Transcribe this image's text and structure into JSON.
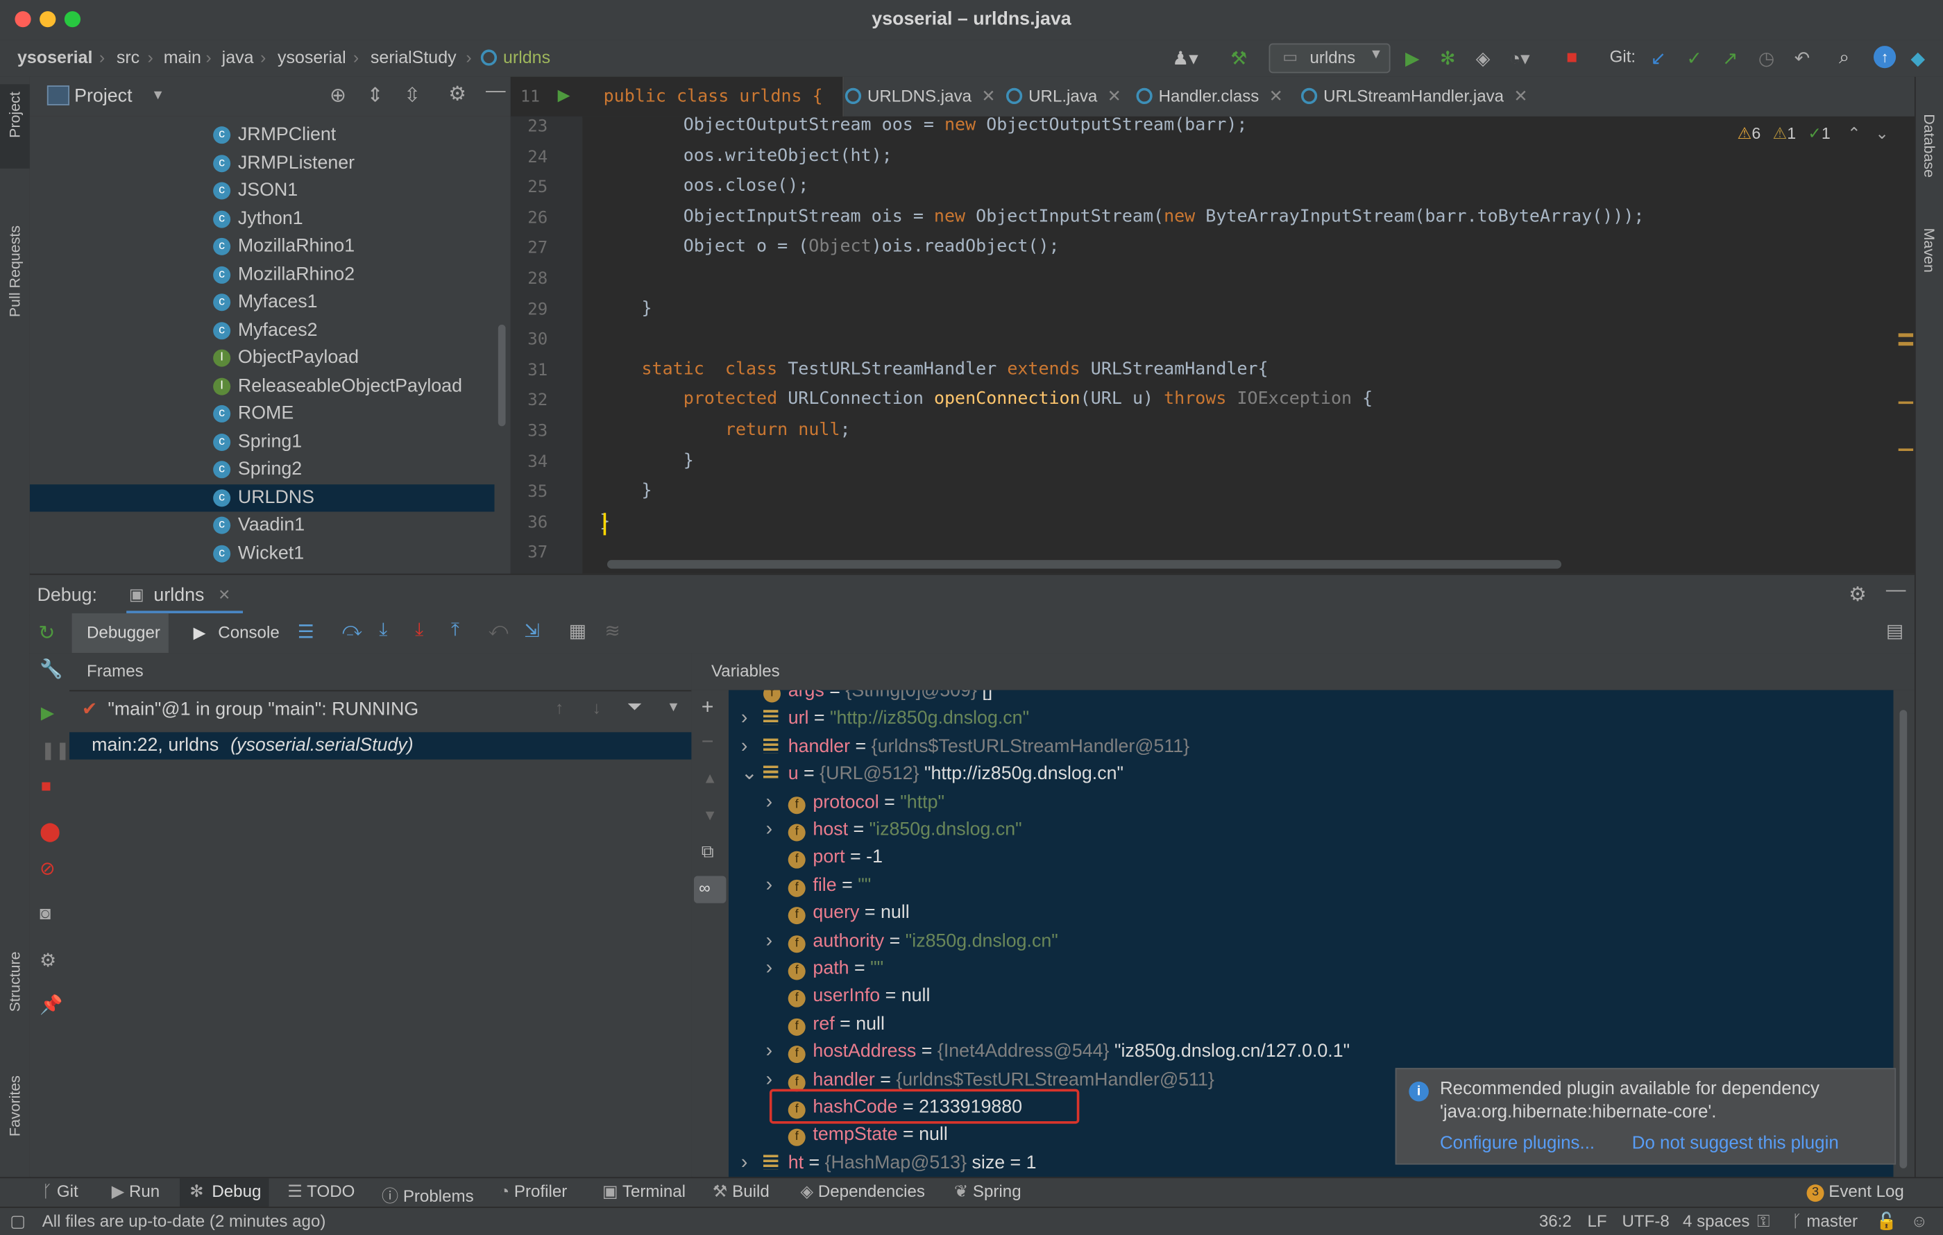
{
  "window": {
    "title": "ysoserial – urldns.java"
  },
  "breadcrumb": [
    "ysoserial",
    "src",
    "main",
    "java",
    "ysoserial",
    "serialStudy",
    "urldns"
  ],
  "toolbar": {
    "run_config": "urldns",
    "git_label": "Git:"
  },
  "project_panel": {
    "title": "Project",
    "items": [
      {
        "label": "JRMPClient",
        "kind": "class"
      },
      {
        "label": "JRMPListener",
        "kind": "class"
      },
      {
        "label": "JSON1",
        "kind": "class"
      },
      {
        "label": "Jython1",
        "kind": "class"
      },
      {
        "label": "MozillaRhino1",
        "kind": "class"
      },
      {
        "label": "MozillaRhino2",
        "kind": "class"
      },
      {
        "label": "Myfaces1",
        "kind": "class"
      },
      {
        "label": "Myfaces2",
        "kind": "class"
      },
      {
        "label": "ObjectPayload",
        "kind": "interface"
      },
      {
        "label": "ReleaseableObjectPayload",
        "kind": "interface"
      },
      {
        "label": "ROME",
        "kind": "class"
      },
      {
        "label": "Spring1",
        "kind": "class"
      },
      {
        "label": "Spring2",
        "kind": "class"
      },
      {
        "label": "URLDNS",
        "kind": "class",
        "selected": true
      },
      {
        "label": "Vaadin1",
        "kind": "class"
      },
      {
        "label": "Wicket1",
        "kind": "class"
      }
    ]
  },
  "left_strip": {
    "project": "Project",
    "pull_requests": "Pull Requests",
    "structure": "Structure",
    "favorites": "Favorites"
  },
  "right_strip": {
    "database": "Database",
    "maven": "Maven"
  },
  "editor": {
    "sticky_line": "11",
    "sticky_code": "public class urldns {",
    "tabs": [
      "URLDNS.java",
      "URL.java",
      "Handler.class",
      "URLStreamHandler.java"
    ],
    "inspections": {
      "warnings": "6",
      "weak": "1",
      "ok": "1"
    },
    "lines": [
      {
        "n": "23",
        "code": "        ObjectOutputStream oos = new ObjectOutputStream(barr);"
      },
      {
        "n": "24",
        "code": "        oos.writeObject(ht);"
      },
      {
        "n": "25",
        "code": "        oos.close();"
      },
      {
        "n": "26",
        "code": "        ObjectInputStream ois = new ObjectInputStream(new ByteArrayInputStream(barr.toByteArray()));"
      },
      {
        "n": "27",
        "code": "        Object o = (Object)ois.readObject();"
      },
      {
        "n": "28",
        "code": ""
      },
      {
        "n": "29",
        "code": "    }"
      },
      {
        "n": "30",
        "code": ""
      },
      {
        "n": "31",
        "code": "    static  class TestURLStreamHandler extends URLStreamHandler{"
      },
      {
        "n": "32",
        "code": "        protected URLConnection openConnection(URL u) throws IOException {"
      },
      {
        "n": "33",
        "code": "            return null;"
      },
      {
        "n": "34",
        "code": "        }"
      },
      {
        "n": "35",
        "code": "    }"
      },
      {
        "n": "36",
        "code": "}"
      },
      {
        "n": "37",
        "code": ""
      }
    ]
  },
  "debug": {
    "label": "Debug:",
    "session": "urldns",
    "tab_debugger": "Debugger",
    "tab_console": "Console",
    "frames_title": "Frames",
    "thread": "\"main\"@1 in group \"main\": RUNNING",
    "frame": "main:22, urldns",
    "frame_pkg": "(ysoserial.serialStudy)",
    "variables_title": "Variables",
    "variables": [
      {
        "indent": 0,
        "name": "args",
        "sep": " = ",
        "gray": "{String[0]@509}",
        "value": " []",
        "kind": "f"
      },
      {
        "indent": 0,
        "name": "url",
        "sep": " = ",
        "str": "\"http://iz850g.dnslog.cn\"",
        "kind": "eq",
        "expand": "right"
      },
      {
        "indent": 0,
        "name": "handler",
        "sep": " = ",
        "gray": "{urldns$TestURLStreamHandler@511}",
        "kind": "eq",
        "expand": "right"
      },
      {
        "indent": 0,
        "name": "u",
        "sep": " = ",
        "gray": "{URL@512}",
        "value": " \"http://iz850g.dnslog.cn\"",
        "kind": "eq",
        "expand": "down"
      },
      {
        "indent": 1,
        "name": "protocol",
        "sep": " = ",
        "str": "\"http\"",
        "kind": "f",
        "expand": "right"
      },
      {
        "indent": 1,
        "name": "host",
        "sep": " = ",
        "str": "\"iz850g.dnslog.cn\"",
        "kind": "f",
        "expand": "right"
      },
      {
        "indent": 1,
        "name": "port",
        "sep": " = ",
        "value": "-1",
        "kind": "f"
      },
      {
        "indent": 1,
        "name": "file",
        "sep": " = ",
        "str": "\"\"",
        "kind": "f",
        "expand": "right"
      },
      {
        "indent": 1,
        "name": "query",
        "sep": " = ",
        "value": "null",
        "kind": "f"
      },
      {
        "indent": 1,
        "name": "authority",
        "sep": " = ",
        "str": "\"iz850g.dnslog.cn\"",
        "kind": "f",
        "expand": "right"
      },
      {
        "indent": 1,
        "name": "path",
        "sep": " = ",
        "str": "\"\"",
        "kind": "f",
        "expand": "right"
      },
      {
        "indent": 1,
        "name": "userInfo",
        "sep": " = ",
        "value": "null",
        "kind": "f"
      },
      {
        "indent": 1,
        "name": "ref",
        "sep": " = ",
        "value": "null",
        "kind": "f"
      },
      {
        "indent": 1,
        "name": "hostAddress",
        "sep": " = ",
        "gray": "{Inet4Address@544}",
        "value": " \"iz850g.dnslog.cn/127.0.0.1\"",
        "kind": "f",
        "expand": "right"
      },
      {
        "indent": 1,
        "name": "handler",
        "sep": " = ",
        "gray": "{urldns$TestURLStreamHandler@511}",
        "kind": "f",
        "expand": "right"
      },
      {
        "indent": 1,
        "name": "hashCode",
        "sep": " = ",
        "value": "2133919880",
        "kind": "f",
        "highlight": true
      },
      {
        "indent": 1,
        "name": "tempState",
        "sep": " = ",
        "value": "null",
        "kind": "f"
      },
      {
        "indent": 0,
        "name": "ht",
        "sep": " = ",
        "gray": "{HashMap@513}",
        "value": "  size = 1",
        "kind": "eq",
        "expand": "right"
      }
    ]
  },
  "notification": {
    "text": "Recommended plugin available for dependency 'java:org.hibernate:hibernate-core'.",
    "action1": "Configure plugins...",
    "action2": "Do not suggest this plugin"
  },
  "bottom_tabs": [
    "Git",
    "Run",
    "Debug",
    "TODO",
    "Problems",
    "Profiler",
    "Terminal",
    "Build",
    "Dependencies",
    "Spring"
  ],
  "event_log": {
    "count": "3",
    "label": "Event Log"
  },
  "status": {
    "message": "All files are up-to-date (2 minutes ago)",
    "position": "36:2",
    "line_sep": "LF",
    "encoding": "UTF-8",
    "indent": "4 spaces",
    "branch": "master"
  },
  "colors": {
    "highlight_box": "#d9342b",
    "var_bg": "#0d293e",
    "selection": "#0d293e"
  }
}
